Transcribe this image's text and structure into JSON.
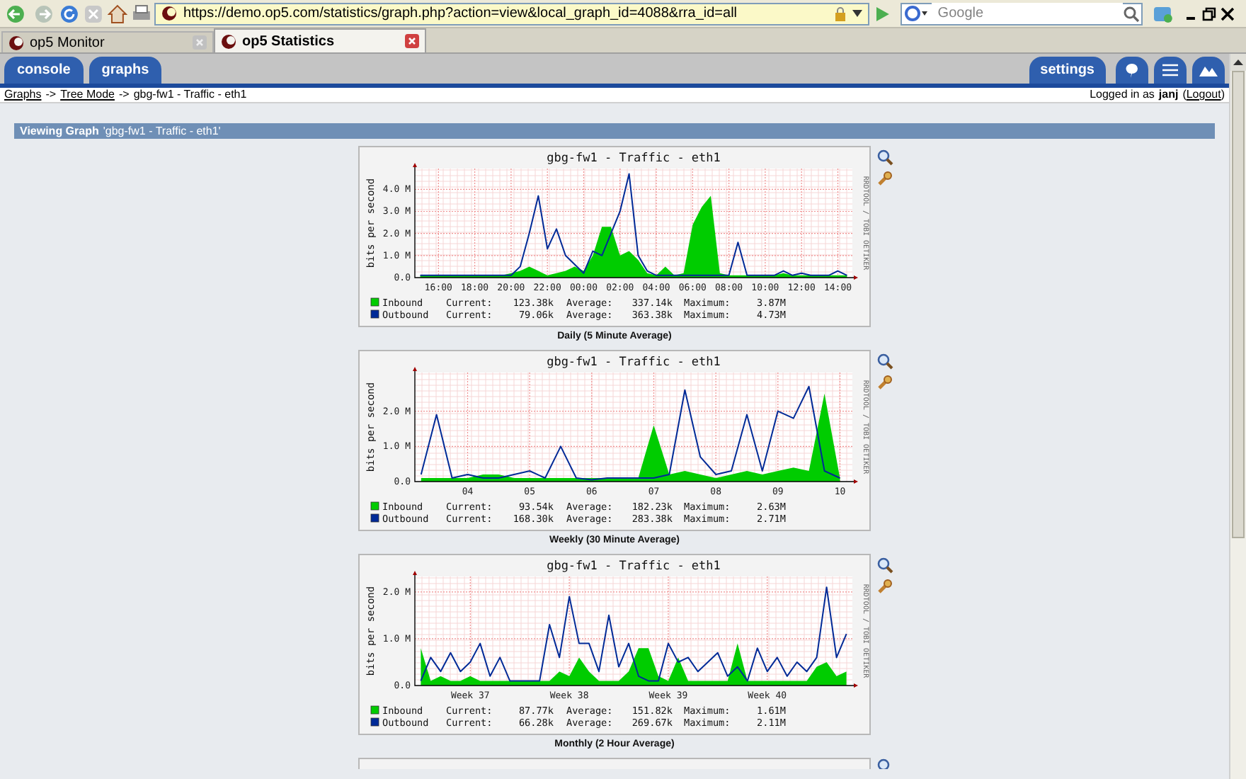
{
  "browser": {
    "url": "https://demo.op5.com/statistics/graph.php?action=view&local_graph_id=4088&rra_id=all",
    "search": {
      "placeholder": "Google"
    },
    "tabs": [
      {
        "label": "op5 Monitor",
        "selected": false
      },
      {
        "label": "op5 Statistics",
        "selected": true
      }
    ]
  },
  "app_tabs": [
    {
      "label": "console"
    },
    {
      "label": "graphs"
    }
  ],
  "settings": {
    "label": "settings"
  },
  "breadcrumb": [
    {
      "label": "Graphs",
      "kind": "link"
    },
    {
      "label": "->",
      "kind": "text"
    },
    {
      "label": "Tree Mode",
      "kind": "link"
    },
    {
      "label": "->",
      "kind": "text"
    },
    {
      "label": "gbg-fw1 - Traffic - eth1",
      "kind": "text"
    }
  ],
  "login": {
    "prefix": "Logged in as",
    "user": "janj",
    "open": "(",
    "logout": "Logout",
    "close": ")"
  },
  "panel": {
    "label": "Viewing Graph",
    "value": "'gbg-fw1 - Traffic - eth1'"
  },
  "graphs": [
    {
      "chart_data": {
        "type": "area",
        "title": "gbg-fw1 - Traffic - eth1",
        "ylabel": "bits per second",
        "grid": true,
        "legend": "bottom",
        "categories": [
          null,
          null,
          "16:00",
          null,
          null,
          null,
          "18:00",
          null,
          null,
          null,
          "20:00",
          null,
          null,
          null,
          "22:00",
          null,
          null,
          null,
          "00:00",
          null,
          null,
          null,
          "02:00",
          null,
          null,
          null,
          "04:00",
          null,
          null,
          null,
          "06:00",
          null,
          null,
          null,
          "08:00",
          null,
          null,
          null,
          "10:00",
          null,
          null,
          null,
          "12:00",
          null,
          null,
          null,
          "14:00",
          null
        ],
        "series": [
          {
            "name": "Inbound",
            "type": "area",
            "color": "#00cc00",
            "values": [
              0.1,
              0.1,
              0.1,
              0.1,
              0.1,
              0.1,
              0.1,
              0.1,
              0.1,
              0.1,
              0.2,
              0.3,
              0.5,
              0.3,
              0.1,
              0.2,
              0.3,
              0.5,
              0.3,
              1.0,
              2.3,
              2.3,
              1.0,
              1.2,
              0.8,
              0.2,
              0.1,
              0.5,
              0.1,
              0.2,
              2.4,
              3.2,
              3.7,
              0.2,
              0.1,
              0.1,
              0.1,
              0.1,
              0.1,
              0.1,
              0.2,
              0.1,
              0.1,
              0.1,
              0.1,
              0.1,
              0.1,
              0.1
            ]
          },
          {
            "name": "Outbound",
            "type": "line",
            "color": "#002a97",
            "values": [
              0.1,
              0.1,
              0.1,
              0.1,
              0.1,
              0.1,
              0.1,
              0.1,
              0.1,
              0.1,
              0.1,
              0.5,
              2.0,
              3.7,
              1.3,
              2.2,
              1.0,
              0.6,
              0.2,
              1.2,
              1.0,
              2.0,
              3.0,
              4.7,
              1.0,
              0.3,
              0.1,
              0.1,
              0.1,
              0.1,
              0.1,
              0.1,
              0.1,
              0.1,
              0.1,
              1.6,
              0.1,
              0.1,
              0.1,
              0.1,
              0.3,
              0.1,
              0.2,
              0.1,
              0.1,
              0.1,
              0.3,
              0.1
            ]
          }
        ],
        "ylim": [
          0,
          4.94
        ],
        "yticks": [
          {
            "value": 0,
            "label": "0.0"
          },
          {
            "value": 1,
            "label": "1.0 M"
          },
          {
            "value": 2,
            "label": "2.0 M"
          },
          {
            "value": 3,
            "label": "3.0 M"
          },
          {
            "value": 4,
            "label": "4.0 M"
          }
        ]
      },
      "watermark": "RRDTOOL / TOBI OETIKER",
      "legend": [
        {
          "current_label": "Current:",
          "current": "123.38k",
          "average_label": "Average:",
          "average": "337.14k",
          "maximum_label": "Maximum:",
          "maximum": "3.87M"
        },
        {
          "current_label": "Current:",
          "current": "79.06k",
          "average_label": "Average:",
          "average": "363.38k",
          "maximum_label": "Maximum:",
          "maximum": "4.73M"
        }
      ],
      "caption": "Daily (5 Minute Average)"
    },
    {
      "chart_data": {
        "type": "area",
        "title": "gbg-fw1 - Traffic - eth1",
        "ylabel": "bits per second",
        "grid": true,
        "legend": "bottom",
        "x": [
          3.25,
          3.5,
          3.75,
          4,
          4.25,
          4.5,
          4.75,
          5,
          5.25,
          5.5,
          5.75,
          6,
          6.25,
          6.5,
          6.75,
          7,
          7.25,
          7.5,
          7.75,
          8,
          8.25,
          8.5,
          8.75,
          9,
          9.25,
          9.5,
          9.75,
          10
        ],
        "series": [
          {
            "name": "Inbound",
            "type": "area",
            "color": "#00cc00",
            "values": [
              0.1,
              0.1,
              0.1,
              0.1,
              0.2,
              0.2,
              0.1,
              0.1,
              0.1,
              0.1,
              0.1,
              0.1,
              0.1,
              0.1,
              0.1,
              1.6,
              0.2,
              0.3,
              0.2,
              0.1,
              0.2,
              0.3,
              0.2,
              0.3,
              0.4,
              0.3,
              2.5,
              0.1
            ]
          },
          {
            "name": "Outbound",
            "type": "line",
            "color": "#002a97",
            "values": [
              0.2,
              1.9,
              0.1,
              0.2,
              0.1,
              0.1,
              0.2,
              0.3,
              0.1,
              1.0,
              0.1,
              0.05,
              0.1,
              0.1,
              0.1,
              0.1,
              0.2,
              2.6,
              0.7,
              0.2,
              0.3,
              1.9,
              0.3,
              2.0,
              1.8,
              2.7,
              0.3,
              0.1
            ]
          }
        ],
        "xlim": [
          3.15,
          10.2
        ],
        "ylim": [
          0,
          3.1
        ],
        "xticks": [
          {
            "value": 4,
            "label": "04"
          },
          {
            "value": 5,
            "label": "05"
          },
          {
            "value": 6,
            "label": "06"
          },
          {
            "value": 7,
            "label": "07"
          },
          {
            "value": 8,
            "label": "08"
          },
          {
            "value": 9,
            "label": "09"
          },
          {
            "value": 10,
            "label": "10"
          }
        ],
        "yticks": [
          {
            "value": 0,
            "label": "0.0"
          },
          {
            "value": 1,
            "label": "1.0 M"
          },
          {
            "value": 2,
            "label": "2.0 M"
          }
        ]
      },
      "watermark": "RRDTOOL / TOBI OETIKER",
      "legend": [
        {
          "current_label": "Current:",
          "current": "93.54k",
          "average_label": "Average:",
          "average": "182.23k",
          "maximum_label": "Maximum:",
          "maximum": "2.63M"
        },
        {
          "current_label": "Current:",
          "current": "168.30k",
          "average_label": "Average:",
          "average": "283.38k",
          "maximum_label": "Maximum:",
          "maximum": "2.71M"
        }
      ],
      "caption": "Weekly (30 Minute Average)"
    },
    {
      "chart_data": {
        "type": "area",
        "title": "gbg-fw1 - Traffic - eth1",
        "ylabel": "bits per second",
        "grid": true,
        "legend": "bottom",
        "categories": [
          null,
          null,
          null,
          null,
          null,
          "Week 37",
          null,
          null,
          null,
          null,
          null,
          null,
          null,
          null,
          null,
          "Week 38",
          null,
          null,
          null,
          null,
          null,
          null,
          null,
          null,
          null,
          "Week 39",
          null,
          null,
          null,
          null,
          null,
          null,
          null,
          null,
          null,
          "Week 40",
          null,
          null,
          null,
          null,
          null,
          null,
          null,
          null
        ],
        "series": [
          {
            "name": "Inbound",
            "type": "area",
            "color": "#00cc00",
            "values": [
              0.8,
              0.1,
              0.2,
              0.1,
              0.1,
              0.2,
              0.1,
              0.1,
              0.1,
              0.1,
              0.1,
              0.1,
              0.1,
              0.1,
              0.3,
              0.2,
              0.6,
              0.3,
              0.1,
              0.1,
              0.1,
              0.3,
              0.8,
              0.8,
              0.2,
              0.1,
              0.6,
              0.1,
              0.1,
              0.1,
              0.1,
              0.1,
              0.9,
              0.1,
              0.1,
              0.1,
              0.1,
              0.1,
              0.1,
              0.1,
              0.4,
              0.5,
              0.2,
              0.3
            ]
          },
          {
            "name": "Outbound",
            "type": "line",
            "color": "#002a97",
            "values": [
              0.1,
              0.6,
              0.3,
              0.7,
              0.3,
              0.5,
              0.9,
              0.2,
              0.6,
              0.1,
              0.1,
              0.1,
              0.1,
              1.3,
              0.6,
              1.9,
              0.9,
              0.9,
              0.3,
              1.5,
              0.4,
              0.9,
              0.2,
              0.1,
              0.1,
              0.9,
              0.5,
              0.6,
              0.3,
              0.5,
              0.7,
              0.2,
              0.4,
              0.1,
              0.8,
              0.3,
              0.6,
              0.2,
              0.5,
              0.3,
              0.6,
              2.1,
              0.6,
              1.1
            ]
          }
        ],
        "ylim": [
          0,
          2.33
        ],
        "yticks": [
          {
            "value": 0,
            "label": "0.0"
          },
          {
            "value": 1,
            "label": "1.0 M"
          },
          {
            "value": 2,
            "label": "2.0 M"
          }
        ]
      },
      "watermark": "RRDTOOL / TOBI OETIKER",
      "legend": [
        {
          "current_label": "Current:",
          "current": "87.77k",
          "average_label": "Average:",
          "average": "151.82k",
          "maximum_label": "Maximum:",
          "maximum": "1.61M"
        },
        {
          "current_label": "Current:",
          "current": "66.28k",
          "average_label": "Average:",
          "average": "269.67k",
          "maximum_label": "Maximum:",
          "maximum": "2.11M"
        }
      ],
      "caption": "Monthly (2 Hour Average)"
    }
  ]
}
